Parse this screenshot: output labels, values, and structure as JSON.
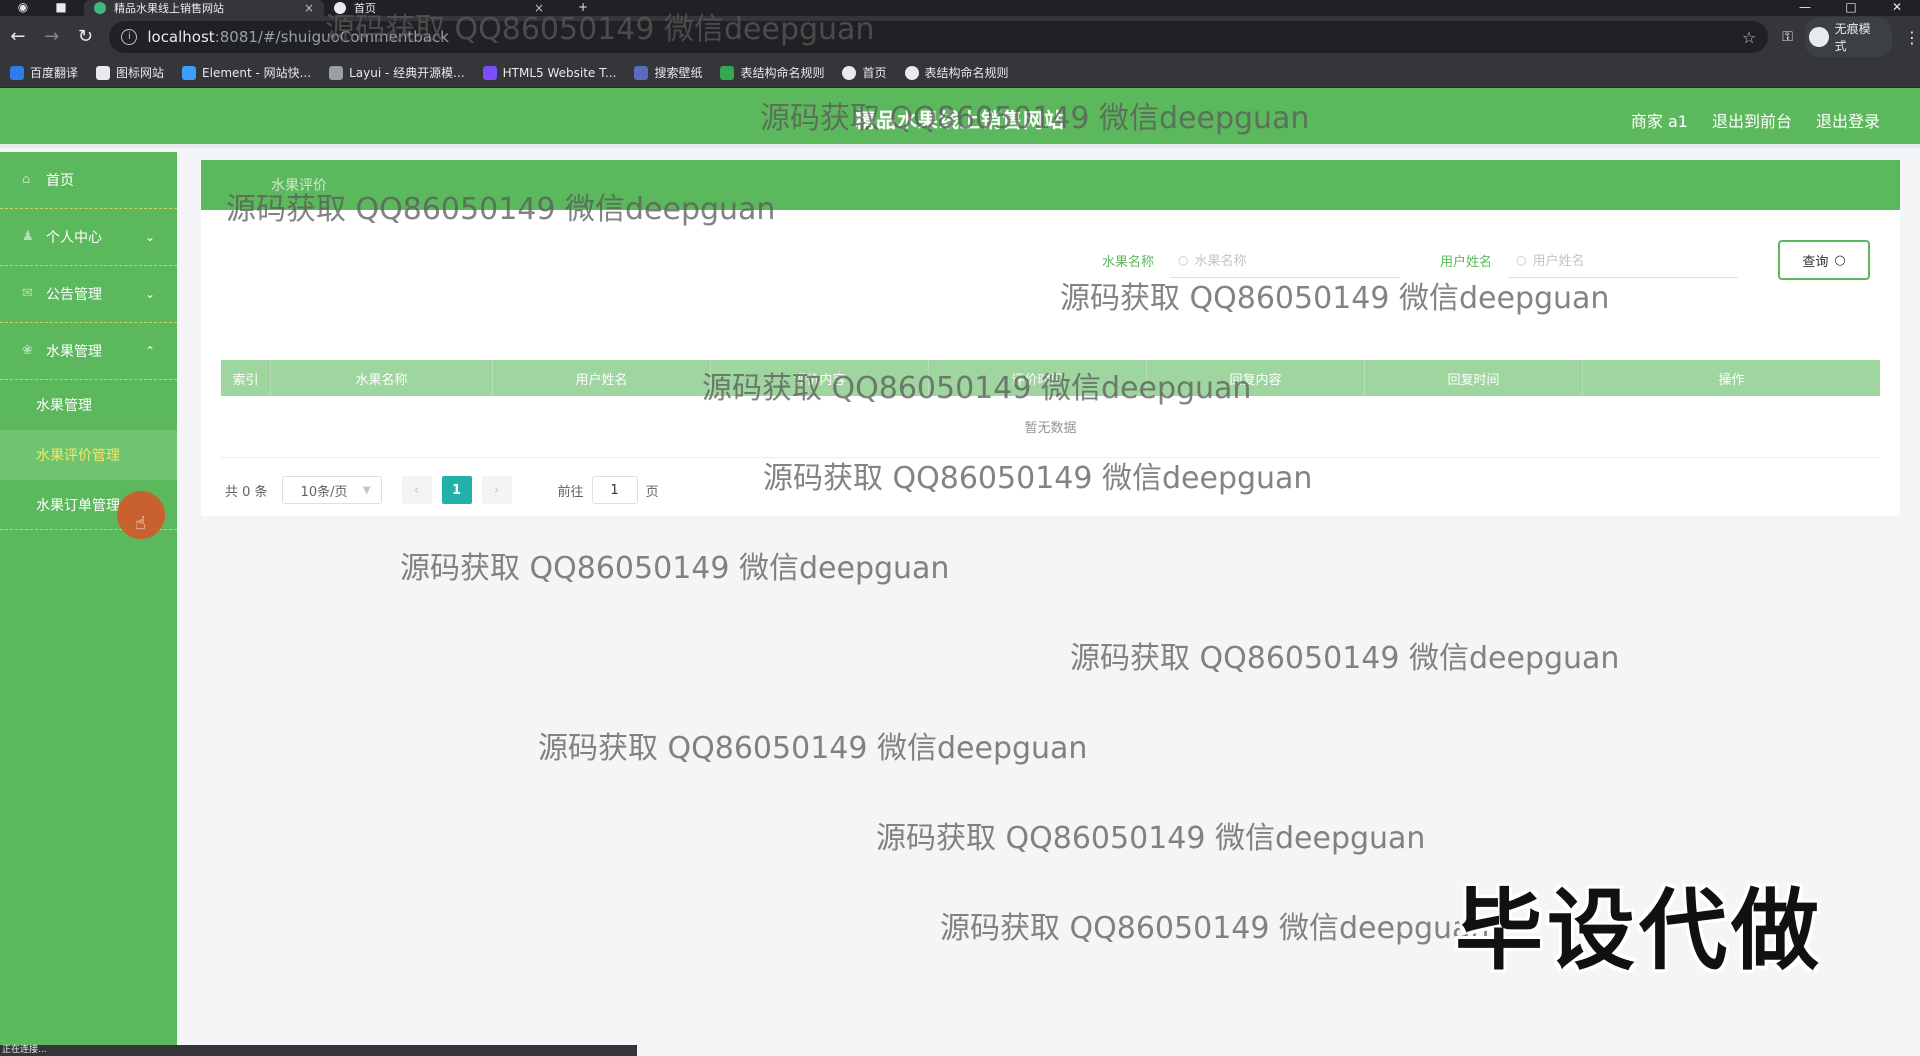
{
  "browser": {
    "tabs": [
      {
        "title": "精品水果线上销售网站",
        "active": true
      },
      {
        "title": "首页",
        "active": false
      }
    ],
    "url_host": "localhost",
    "url_path": ":8081/#/shuiguoCommentback",
    "profile_label": "无痕模式",
    "bookmarks": [
      "百度翻译",
      "图标网站",
      "Element - 网站快...",
      "Layui - 经典开源模...",
      "HTML5 Website T...",
      "搜索壁纸",
      "表结构命名规则",
      "首页",
      "表结构命名规则"
    ],
    "status_text": "正在连接..."
  },
  "header": {
    "title": "精品水果线上销售网站",
    "user_label": "商家 a1",
    "back_label": "退出到前台",
    "logout_label": "退出登录"
  },
  "sidebar": {
    "home": "首页",
    "personal": "个人中心",
    "notice": "公告管理",
    "fruit": "水果管理",
    "sub_fruit": "水果管理",
    "sub_comment": "水果评价管理",
    "sub_order": "水果订单管理"
  },
  "breadcrumb": "水果评价",
  "search": {
    "fruit_label": "水果名称",
    "fruit_placeholder": "水果名称",
    "user_label": "用户姓名",
    "user_placeholder": "用户姓名",
    "button": "查询"
  },
  "table": {
    "columns": [
      "索引",
      "水果名称",
      "用户姓名",
      "评价内容",
      "评价时间",
      "回复内容",
      "回复时间",
      "操作"
    ],
    "empty_text": "暂无数据"
  },
  "pagination": {
    "total": "共 0 条",
    "page_size": "10条/页",
    "current_page": "1",
    "goto_label": "前往",
    "goto_value": "1",
    "page_suffix": "页"
  },
  "watermark": "源码获取 QQ86050149 微信deepguan",
  "stamp": "毕设代做",
  "colors": {
    "primary": "#5cb85c",
    "table_header": "#9fd59f",
    "active_page": "#20b2aa",
    "active_menu_text": "#f5e56b"
  }
}
